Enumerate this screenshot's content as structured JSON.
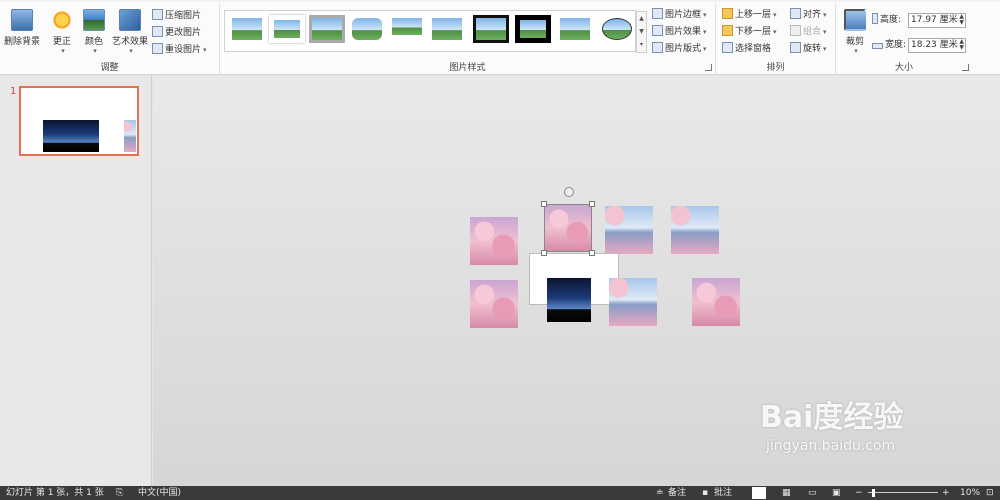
{
  "ribbon": {
    "adjust": {
      "label": "调整",
      "remove_bg": "删除背景",
      "corrections": "更正",
      "color": "颜色",
      "artistic": "艺术效果",
      "compress": "压缩图片",
      "change": "更改图片",
      "reset": "重设图片"
    },
    "styles": {
      "label": "图片样式",
      "border": "图片边框",
      "effects": "图片效果",
      "layout": "图片版式"
    },
    "arrange": {
      "label": "排列",
      "forward": "上移一层",
      "backward": "下移一层",
      "selection_pane": "选择窗格",
      "align": "对齐",
      "group": "组合",
      "rotate": "旋转"
    },
    "size": {
      "label": "大小",
      "crop": "裁剪",
      "height_label": "高度:",
      "height_value": "17.97 厘米",
      "width_label": "宽度:",
      "width_value": "18.23 厘米"
    }
  },
  "thumbs": {
    "slide_number": "1"
  },
  "status": {
    "slide_info": "幻灯片 第 1 张，共 1 张",
    "language": "中文(中国)",
    "notes": "备注",
    "comments": "批注",
    "zoom": "10%"
  },
  "watermark": {
    "big": "Bai度经验",
    "small": "jingyan.baidu.com"
  },
  "colors": {
    "accent": "#d24726",
    "status_bar": "#3a3a3a"
  }
}
